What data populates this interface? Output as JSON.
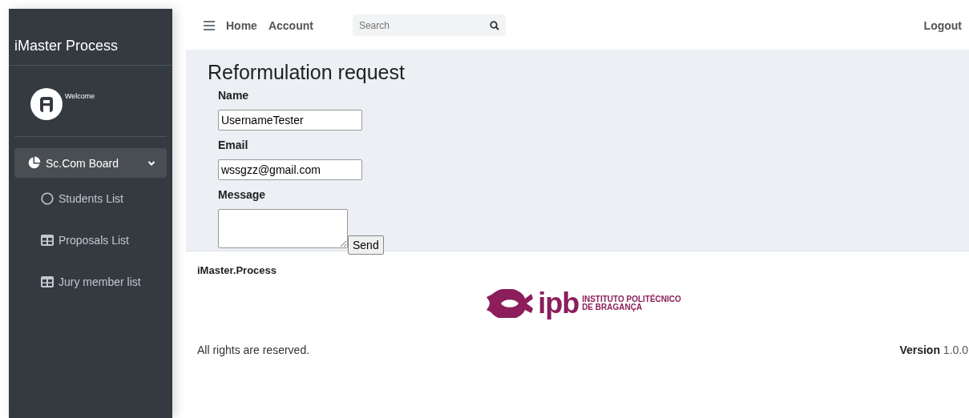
{
  "sidebar": {
    "brand": "iMaster Process",
    "user": {
      "greeting": "Welcome"
    },
    "menu": [
      {
        "label": "Sc.Com Board",
        "kind": "chart",
        "selected": true,
        "expanded": true,
        "children": [
          {
            "label": "Students List",
            "kind": "circle",
            "selected": false
          },
          {
            "label": "Proposals List",
            "kind": "table",
            "selected": false
          },
          {
            "label": "Jury member list",
            "kind": "table",
            "selected": false
          }
        ]
      }
    ]
  },
  "navbar": {
    "links": [
      "Home",
      "Account"
    ],
    "search": {
      "placeholder": "Search"
    },
    "logout": "Logout"
  },
  "form": {
    "title": "Reformulation request",
    "fields": [
      {
        "label": "Name",
        "kind": "input",
        "value": "UsernameTester"
      },
      {
        "label": "Email",
        "kind": "input",
        "value": "wssgzz@gmail.com"
      },
      {
        "label": "Message",
        "kind": "textarea"
      }
    ],
    "submit": "Send"
  },
  "footer": {
    "brand": "iMaster.Process",
    "logo": {
      "mark": "ipb",
      "line_1": "INSTITUTO POLITÉCNICO",
      "line_2": "DE BRAGANÇA"
    },
    "rights": "All rights are reserved.",
    "version": "**Version** 1.0.0"
  }
}
